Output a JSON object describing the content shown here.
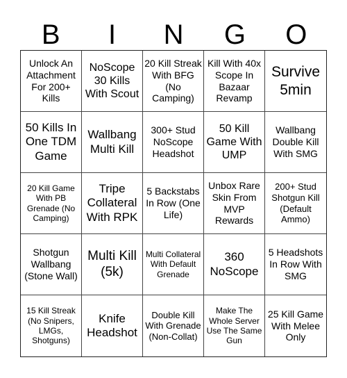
{
  "header": [
    "B",
    "I",
    "N",
    "G",
    "O"
  ],
  "cells": [
    "Unlock An Attachment For 200+ Kills",
    "NoScope 30 Kills With Scout",
    "20 Kill Streak With BFG (No Camping)",
    "Kill With 40x Scope In Bazaar Revamp",
    "Survive 5min",
    "50 Kills In One TDM Game",
    "Wallbang Multi Kill",
    "300+ Stud NoScope Headshot",
    "50 Kill Game With UMP",
    "Wallbang Double Kill With SMG",
    "20 Kill Game With PB Grenade (No Camping)",
    "Tripe Collateral With RPK",
    "5 Backstabs In Row (One Life)",
    "Unbox Rare Skin From MVP Rewards",
    "200+ Stud Shotgun Kill (Default Ammo)",
    "Shotgun Wallbang (Stone Wall)",
    "Multi Kill (5k)",
    "Multi Collateral With Default Grenade",
    "360 NoScope",
    "5 Headshots In Row With SMG",
    "15 Kill Streak (No Snipers, LMGs, Shotguns)",
    "Knife Headshot",
    "Double Kill With Grenade (Non-Collat)",
    "Make The Whole Server Use The Same Gun",
    "25 Kill Game With Melee Only"
  ]
}
